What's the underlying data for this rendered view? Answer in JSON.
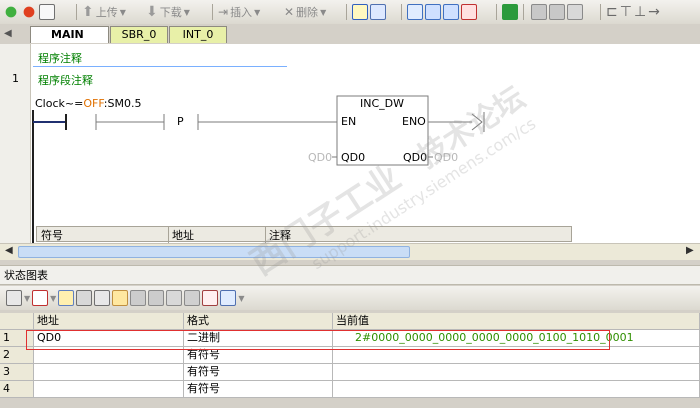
{
  "toolbar": {
    "upload_label": "上传",
    "download_label": "下载",
    "insert_label": "插入",
    "delete_label": "删除"
  },
  "tabs": [
    {
      "label": "MAIN",
      "active": true,
      "close": "×"
    },
    {
      "label": "SBR_0",
      "active": false
    },
    {
      "label": "INT_0",
      "active": false
    }
  ],
  "editor": {
    "program_comment": "程序注释",
    "network_number": "1",
    "network_comment": "程序段注释",
    "contact_prefix": "Clock~=",
    "contact_value": "OFF",
    "contact_address": ":SM0.5",
    "p_contact": "P",
    "box_title": "INC_DW",
    "box_en": "EN",
    "box_eno": "ENO",
    "box_in": "QD0",
    "box_out": "QD0",
    "in_value": "QD0",
    "out_value": "QD0",
    "symbol_headers": [
      "符号",
      "地址",
      "注释"
    ]
  },
  "status_chart": {
    "title": "状态图表",
    "headers": [
      "",
      "地址",
      "格式",
      "当前值"
    ],
    "rows": [
      {
        "num": "1",
        "address": "QD0",
        "format": "二进制",
        "value": "2#0000_0000_0000_0000_0000_0100_1010_0001"
      },
      {
        "num": "2",
        "address": "",
        "format": "有符号",
        "value": ""
      },
      {
        "num": "3",
        "address": "",
        "format": "有符号",
        "value": ""
      },
      {
        "num": "4",
        "address": "",
        "format": "有符号",
        "value": ""
      }
    ]
  },
  "watermark": {
    "line1": "西门子工业",
    "line2": "技术论坛",
    "line3": "support.industry.siemens.com/cs"
  },
  "colors": {
    "value_green": "#2f8f00",
    "off_orange": "#e07000",
    "highlight_red": "#e03030",
    "comment_green": "#008000",
    "tab_active": "#ffffff",
    "tab_inactive": "#e8f0a8"
  }
}
